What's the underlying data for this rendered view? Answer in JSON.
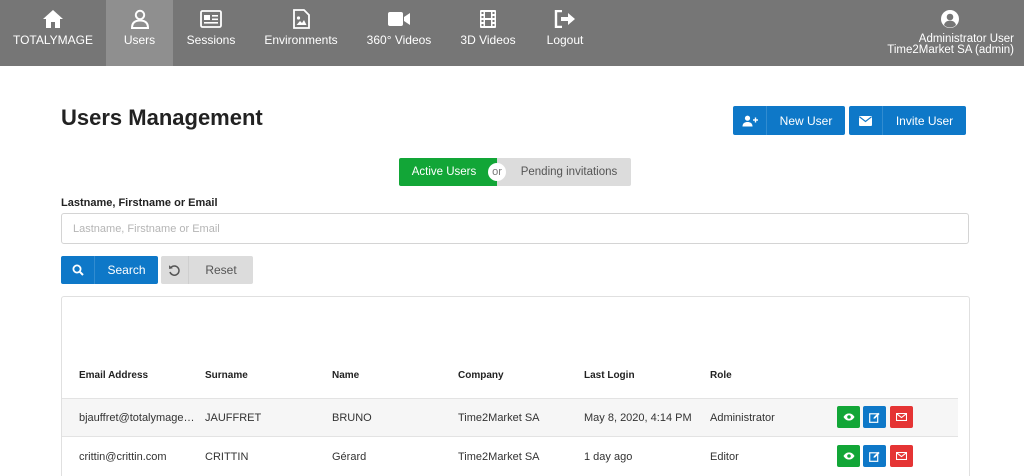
{
  "nav": {
    "items": [
      {
        "label": "TOTALYMAGE",
        "icon": "home-icon"
      },
      {
        "label": "Users",
        "icon": "user-icon",
        "active": true
      },
      {
        "label": "Sessions",
        "icon": "id-card-icon"
      },
      {
        "label": "Environments",
        "icon": "file-image-icon"
      },
      {
        "label": "360° Videos",
        "icon": "video-camera-icon"
      },
      {
        "label": "3D Videos",
        "icon": "film-icon"
      },
      {
        "label": "Logout",
        "icon": "sign-out-icon"
      }
    ],
    "user": {
      "line1": "Administrator User",
      "line2": "Time2Market SA (admin)",
      "icon": "user-circle-icon"
    }
  },
  "page": {
    "title": "Users Management",
    "new_user": "New User",
    "invite_user": "Invite User"
  },
  "toggle": {
    "active": "Active Users",
    "or": "or",
    "pending": "Pending invitations"
  },
  "search": {
    "label": "Lastname, Firstname or Email",
    "placeholder": "Lastname, Firstname or Email",
    "value": "",
    "search_label": "Search",
    "reset_label": "Reset"
  },
  "table": {
    "columns": [
      "Email Address",
      "Surname",
      "Name",
      "Company",
      "Last Login",
      "Role"
    ],
    "rows": [
      {
        "email": "bjauffret@totalymage…",
        "surname": "JAUFFRET",
        "name": "BRUNO",
        "company": "Time2Market SA",
        "last_login": "May 8, 2020, 4:14 PM",
        "role": "Administrator"
      },
      {
        "email": "crittin@crittin.com",
        "surname": "CRITTIN",
        "name": "Gérard",
        "company": "Time2Market SA",
        "last_login": "1 day ago",
        "role": "Editor"
      }
    ]
  },
  "colors": {
    "nav_bg": "#767676",
    "nav_active": "#8f8f8f",
    "primary": "#0e78c8",
    "success": "#12a637",
    "danger": "#e53434",
    "neutral": "#dcdcdc"
  }
}
